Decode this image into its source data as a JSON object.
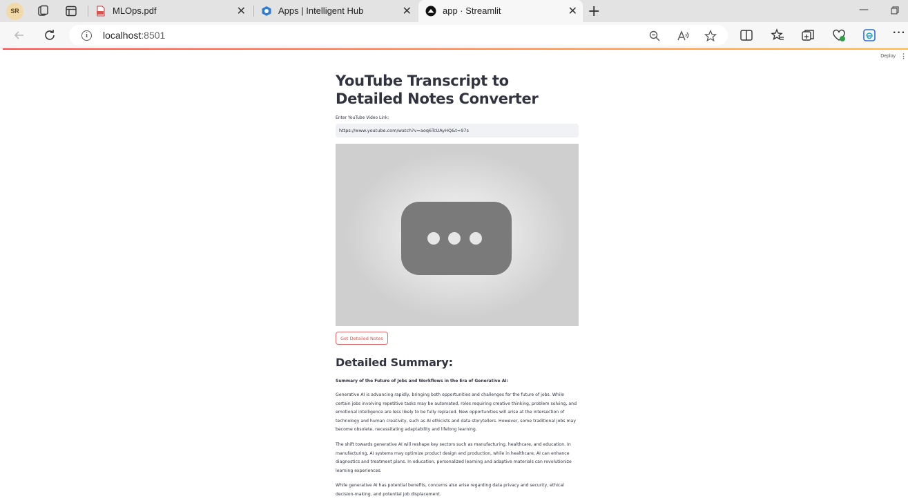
{
  "browser": {
    "profile_initials": "SR",
    "tabs": [
      {
        "title": "MLOps.pdf",
        "icon": "pdf-icon"
      },
      {
        "title": "Apps | Intelligent Hub",
        "icon": "hub-icon"
      },
      {
        "title": "app · Streamlit",
        "icon": "streamlit-icon",
        "active": true
      }
    ],
    "address": {
      "host": "localhost",
      "port": ":8501"
    }
  },
  "streamlit": {
    "deploy_label": "Deploy",
    "menu_glyph": "⋮"
  },
  "app": {
    "title": "YouTube Transcript to Detailed Notes Converter",
    "input_label": "Enter YouTube Video Link:",
    "input_value": "https://www.youtube.com/watch?v=aoq6TcUAyHQ&t=97s",
    "button_label": "Get Detailed Notes",
    "summary_heading": "Detailed Summary:",
    "summary_subheading": "Summary of the Future of Jobs and Workflows in the Era of Generative AI:",
    "paragraphs": [
      "Generative AI is advancing rapidly, bringing both opportunities and challenges for the future of jobs. While certain jobs involving repetitive tasks may be automated, roles requiring creative thinking, problem solving, and emotional intelligence are less likely to be fully replaced. New opportunities will arise at the intersection of technology and human creativity, such as AI ethicists and data storytellers. However, some traditional jobs may become obsolete, necessitating adaptability and lifelong learning.",
      "The shift towards generative AI will reshape key sectors such as manufacturing, healthcare, and education. In manufacturing, AI systems may optimize product design and production, while in healthcare, AI can enhance diagnostics and treatment plans. In education, personalized learning and adaptive materials can revolutionize learning experiences.",
      "While generative AI has potential benefits, concerns also arise regarding data privacy and security, ethical decision-making, and potential job displacement."
    ]
  },
  "colors": {
    "accent": "#ff4b4b",
    "input_bg": "#f0f2f6",
    "text": "#31333f"
  }
}
